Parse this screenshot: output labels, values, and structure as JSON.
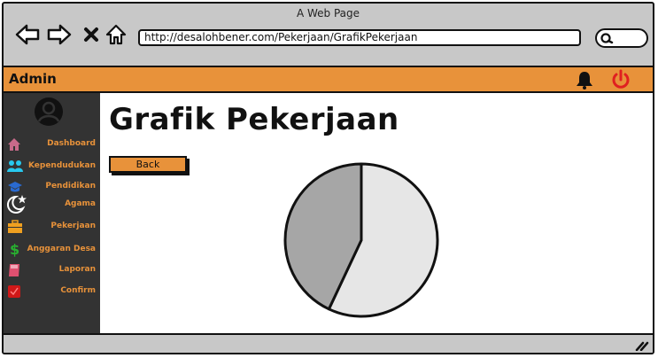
{
  "window": {
    "title": "A Web Page",
    "url": "http://desalohbener.com/Pekerjaan/GrafikPekerjaan"
  },
  "header": {
    "brand": "Admin"
  },
  "sidebar": {
    "items": [
      {
        "label": "Dashboard",
        "icon": "home-icon"
      },
      {
        "label": "Kependudukan",
        "icon": "users-icon"
      },
      {
        "label": "Pendidikan",
        "icon": "graduation-cap-icon"
      },
      {
        "label": "Agama",
        "icon": "moon-star-icon"
      },
      {
        "label": "Pekerjaan",
        "icon": "briefcase-icon"
      },
      {
        "label": "Anggaran Desa",
        "icon": "dollar-icon"
      },
      {
        "label": "Laporan",
        "icon": "book-icon"
      },
      {
        "label": "Confirm",
        "icon": "check-square-icon"
      }
    ]
  },
  "main": {
    "title": "Grafik Pekerjaan",
    "back_label": "Back"
  },
  "colors": {
    "accent": "#e8923a",
    "sidebar_bg": "#333333",
    "power": "#e02020"
  },
  "chart_data": {
    "type": "pie",
    "values": [
      57,
      43
    ],
    "colors": [
      "#e6e6e6",
      "#a6a6a6"
    ]
  }
}
